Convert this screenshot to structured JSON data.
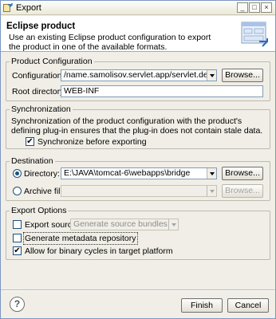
{
  "window": {
    "title": "Export",
    "controls": {
      "minimize": "_",
      "maximize": "□",
      "close": "×"
    }
  },
  "header": {
    "title": "Eclipse product",
    "description": "Use an existing Eclipse product configuration to export the product in one of the available formats."
  },
  "product_configuration": {
    "legend": "Product Configuration",
    "configuration_label": "Configuration:",
    "configuration_value": "/name.samolisov.servlet.app/servlet.demo.product",
    "browse_label": "Browse...",
    "root_label": "Root directory:",
    "root_value": "WEB-INF"
  },
  "synchronization": {
    "legend": "Synchronization",
    "description": "Synchronization of the product configuration with the product's defining plug-in ensures that the plug-in does not contain stale data.",
    "checkbox_label": "Synchronize before exporting",
    "checked": true
  },
  "destination": {
    "legend": "Destination",
    "directory_label": "Directory:",
    "directory_value": "E:\\JAVA\\tomcat-6\\webapps\\bridge",
    "directory_selected": true,
    "browse_label": "Browse...",
    "archive_label": "Archive file:",
    "archive_value": "",
    "archive_browse_label": "Browse..."
  },
  "export_options": {
    "legend": "Export Options",
    "export_source_label": "Export source:",
    "export_source_checked": false,
    "export_source_value": "Generate source bundles",
    "metadata_label": "Generate metadata repository",
    "metadata_checked": false,
    "binary_cycles_label": "Allow for binary cycles in target platform",
    "binary_cycles_checked": true
  },
  "footer": {
    "help": "?",
    "finish_label": "Finish",
    "cancel_label": "Cancel"
  },
  "icons": {
    "check_glyph": "✔"
  }
}
